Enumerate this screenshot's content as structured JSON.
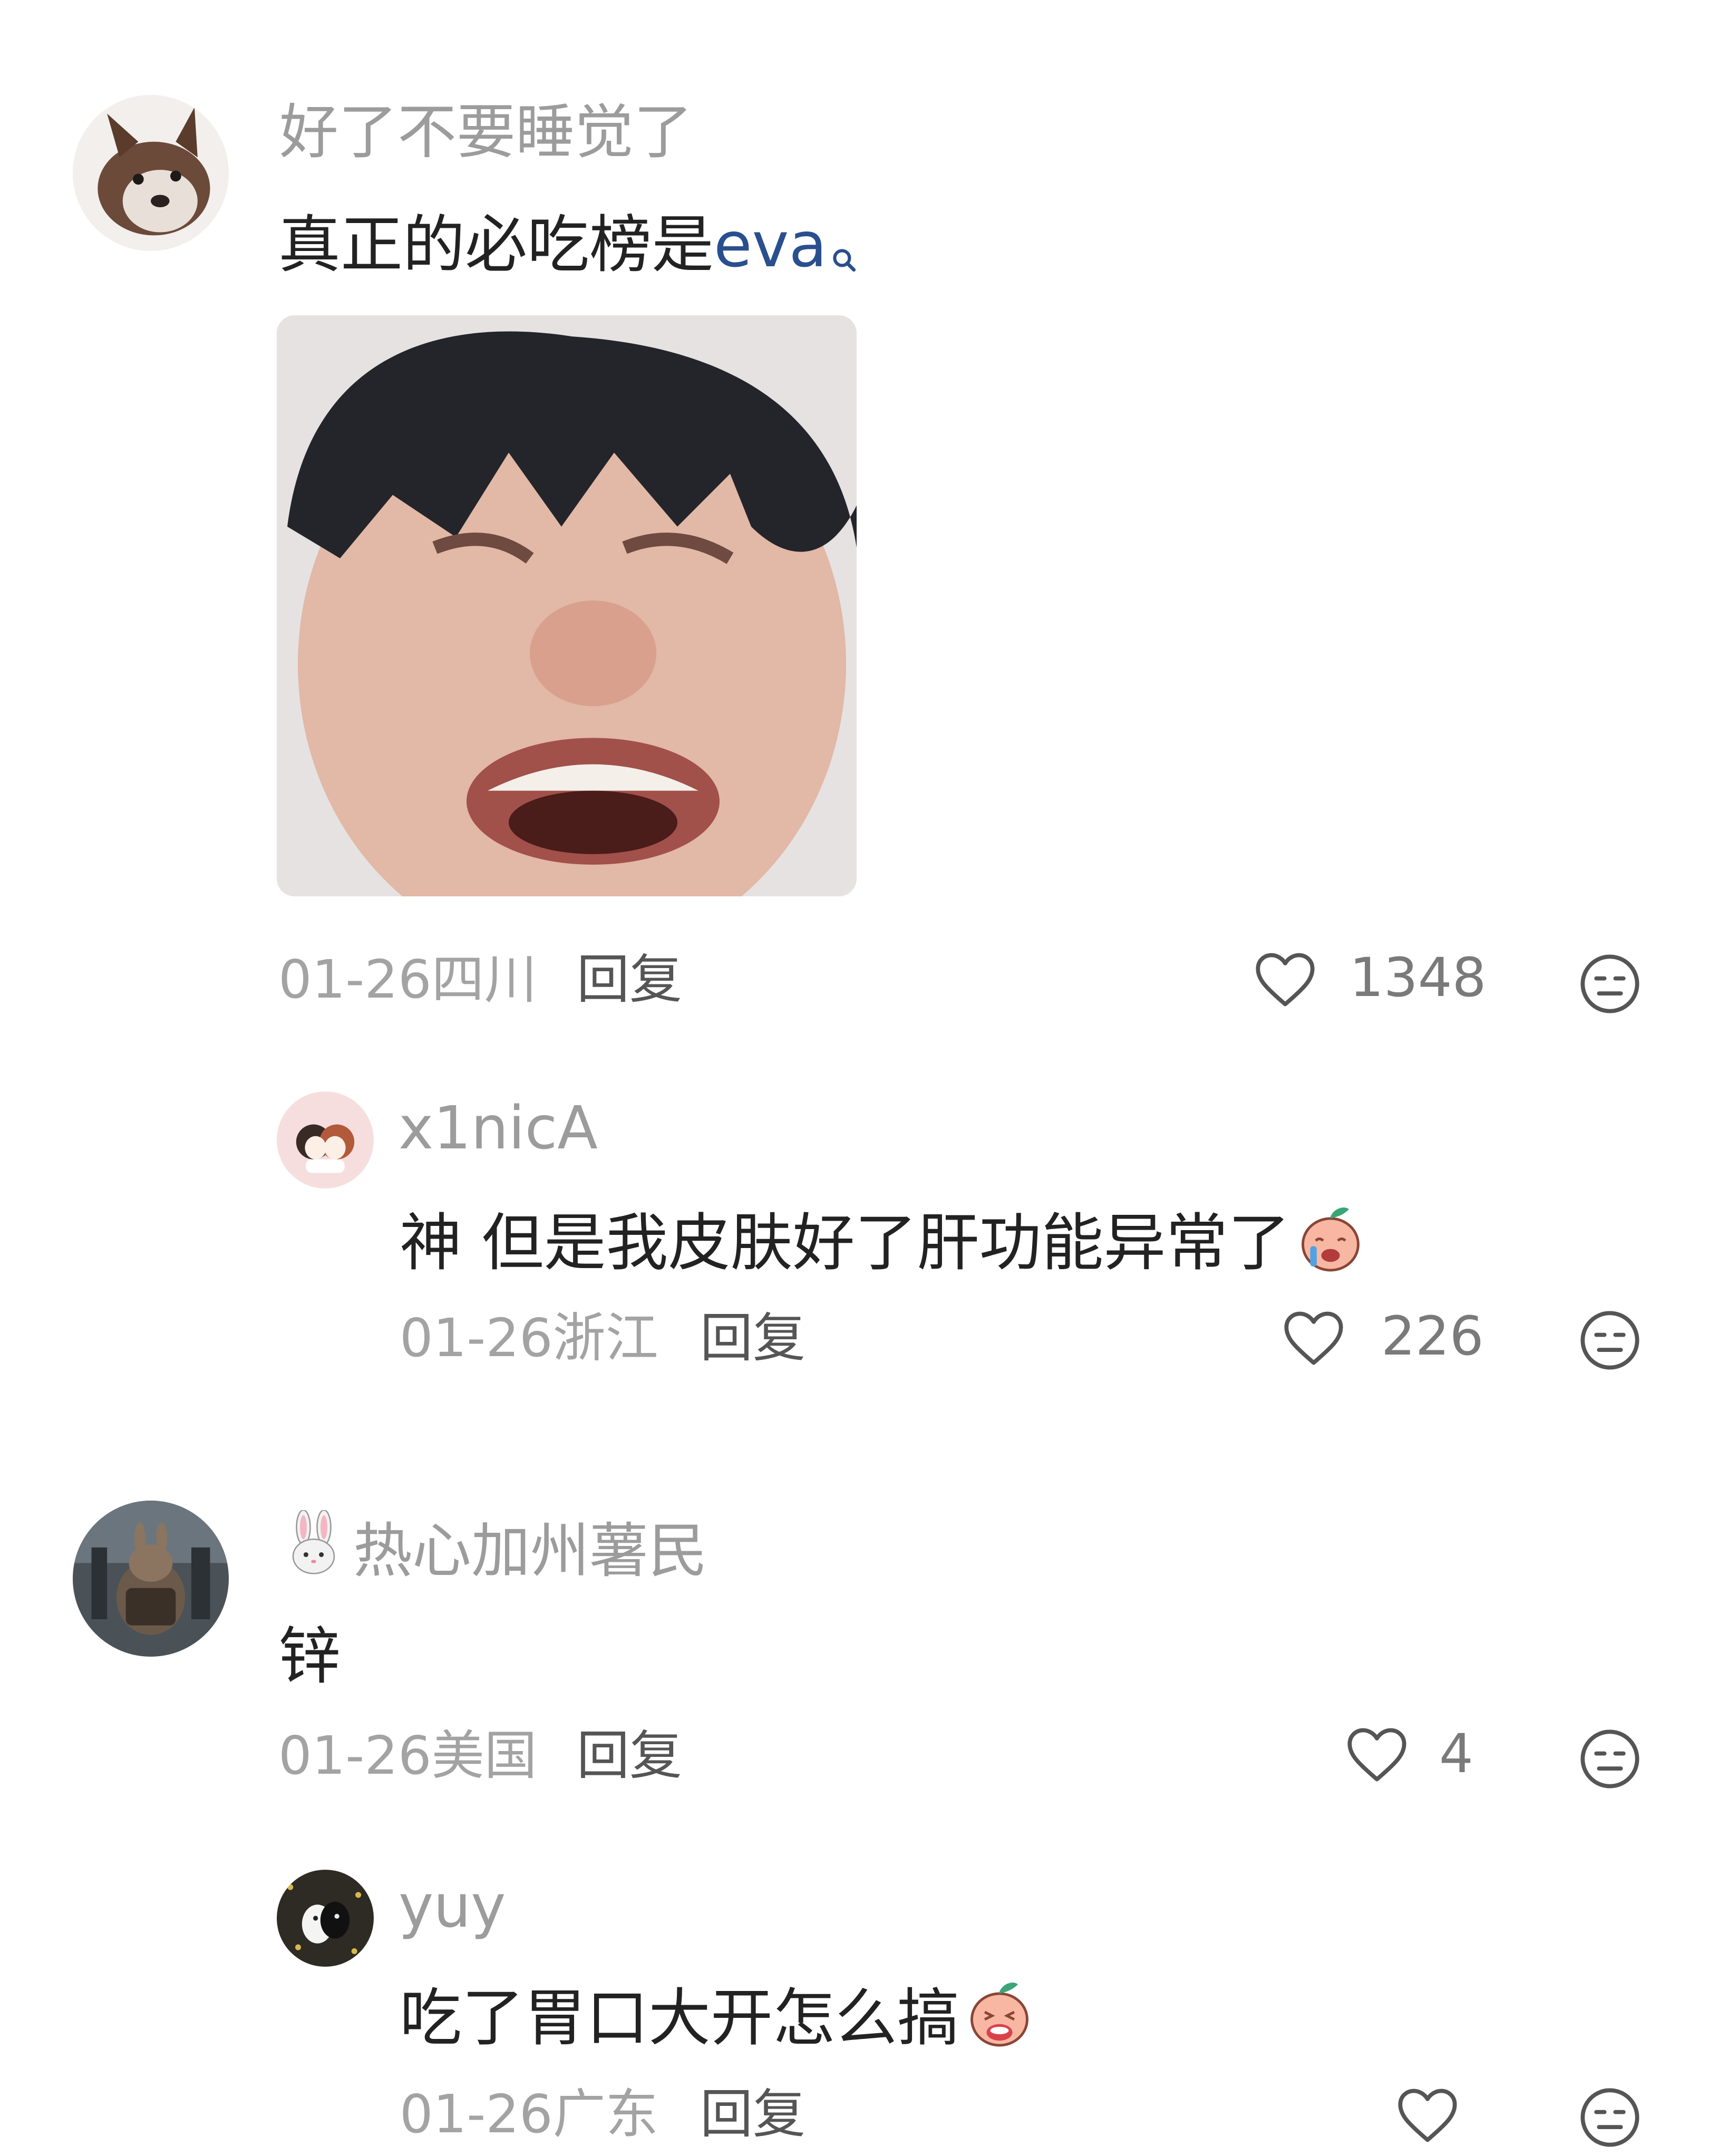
{
  "comments": [
    {
      "username": "好了不要睡觉了",
      "text_before_link": "真正的必吃榜是",
      "link_text": "eva",
      "link_icon": "search-icon",
      "image": "meme-crying-face-photo",
      "date": "01-26",
      "location": "四川",
      "reply_label": "回复",
      "likes": "1348",
      "avatar": "husky-dog-avatar",
      "replies": [
        {
          "username": "x1nicA",
          "text": "神 但是我皮肤好了肝功能异常了",
          "emoji": "crying-peach-emoji",
          "date": "01-26",
          "location": "浙江",
          "reply_label": "回复",
          "likes": "226",
          "avatar": "couple-cartoon-avatar"
        }
      ]
    },
    {
      "username_emoji": "rabbit-face-emoji",
      "username": "热心加州薯民",
      "text": "锌",
      "date": "01-26",
      "location": "美国",
      "reply_label": "回复",
      "likes": "4",
      "avatar": "rabbit-photo-avatar",
      "replies": [
        {
          "username": "yuy",
          "text": "吃了胃口大开怎么搞",
          "emoji": "crying-peach-emoji",
          "date": "01-26",
          "location": "广东",
          "reply_label": "回复",
          "likes": "",
          "avatar": "black-white-cat-avatar"
        }
      ]
    }
  ],
  "colors": {
    "username": "#9c9c9c",
    "body_text": "#222222",
    "meta": "#a3a3a3",
    "link": "#2a4f8f",
    "icon_stroke": "#555555"
  }
}
